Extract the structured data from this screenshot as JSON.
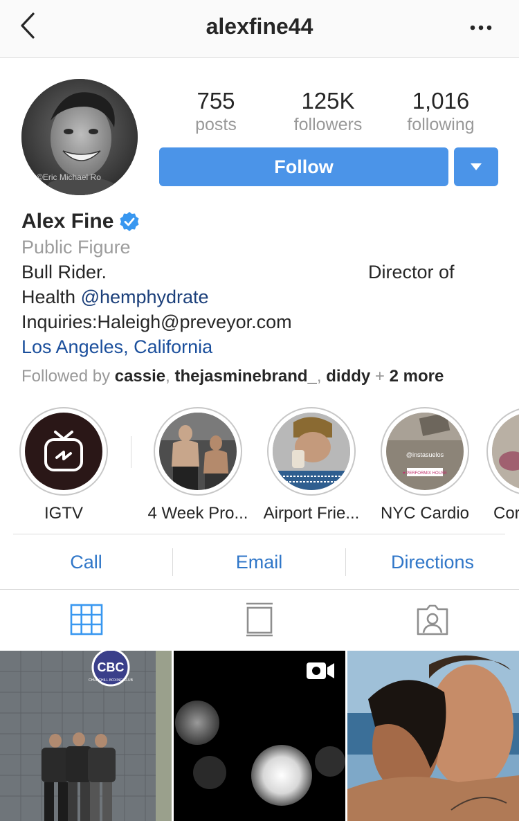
{
  "header": {
    "username": "alexfine44"
  },
  "profile": {
    "posts_count": "755",
    "posts_label": "posts",
    "followers_count": "125K",
    "followers_label": "followers",
    "following_count": "1,016",
    "following_label": "following",
    "follow_label": "Follow",
    "avatar_watermark": "©Eric Michael Ro",
    "name": "Alex Fine",
    "verified": true,
    "category": "Public Figure",
    "bio_line1_left": "Bull Rider.",
    "bio_line1_right": "Director of",
    "bio_line2_text": "Health ",
    "bio_line2_mention": "@hemphydrate",
    "bio_line3": "Inquiries:Haleigh@preveyor.com",
    "location": "Los Angeles, California",
    "followed_by_prefix": "Followed by ",
    "followed_by_users": [
      "cassie",
      "thejasminebrand_",
      "diddy"
    ],
    "followed_by_more": "2 more",
    "accent_color": "#4b94e8"
  },
  "highlights": [
    {
      "label": "IGTV"
    },
    {
      "label": "4 Week Pro..."
    },
    {
      "label": "Airport Frie..."
    },
    {
      "label": "NYC Cardio"
    },
    {
      "label": "Cor"
    }
  ],
  "highlight_overlays": {
    "nyc_cardio_tag": "@instasuelos",
    "nyc_cardio_sticker": "♥ PERFORMIX HOUSE"
  },
  "actions": {
    "call": "Call",
    "email": "Email",
    "directions": "Directions"
  },
  "tabs": [
    "grid-icon",
    "feed-icon",
    "tagged-icon"
  ],
  "posts": [
    {
      "sign_text": "CBC",
      "sign_sub": "CHURCHILL BOXING CLUB"
    },
    {
      "type": "video"
    },
    {
      "type": "photo"
    }
  ]
}
